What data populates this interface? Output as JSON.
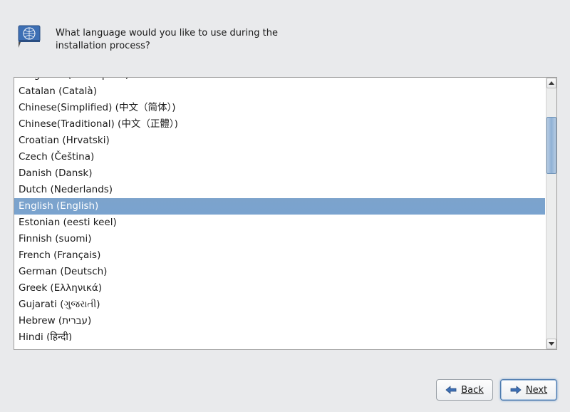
{
  "header": {
    "prompt_line1": "What language would you like to use during the",
    "prompt_line2": "installation process?"
  },
  "languages": [
    "Bulgarian (Български)",
    "Catalan (Català)",
    "Chinese(Simplified) (中文（简体）)",
    "Chinese(Traditional) (中文（正體）)",
    "Croatian (Hrvatski)",
    "Czech (Čeština)",
    "Danish (Dansk)",
    "Dutch (Nederlands)",
    "English (English)",
    "Estonian (eesti keel)",
    "Finnish (suomi)",
    "French (Français)",
    "German (Deutsch)",
    "Greek (Ελληνικά)",
    "Gujarati (ગુજરાતી)",
    "Hebrew (עברית)",
    "Hindi (हिन्दी)"
  ],
  "selected_index": 8,
  "buttons": {
    "back": "Back",
    "next": "Next"
  }
}
